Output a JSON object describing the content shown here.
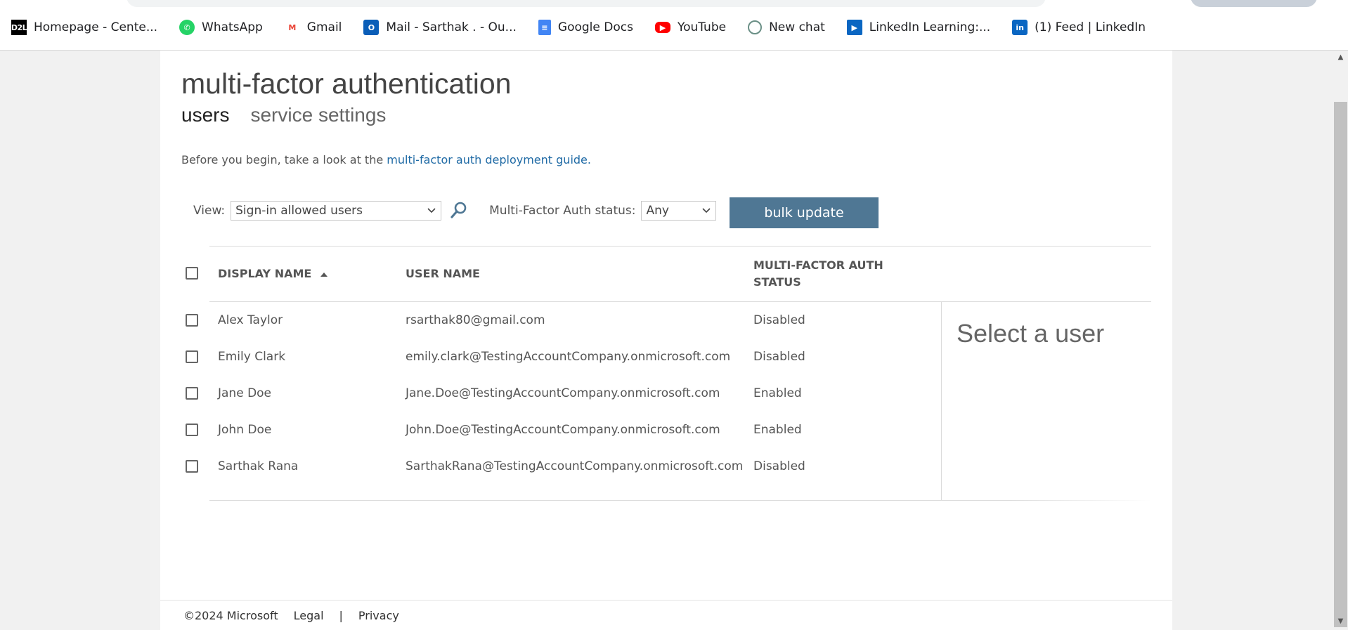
{
  "bookmarks": [
    {
      "label": "Homepage - Cente...",
      "icon": "d2l-icon"
    },
    {
      "label": "WhatsApp",
      "icon": "whatsapp-icon"
    },
    {
      "label": "Gmail",
      "icon": "gmail-icon"
    },
    {
      "label": "Mail - Sarthak . - Ou...",
      "icon": "outlook-icon"
    },
    {
      "label": "Google Docs",
      "icon": "google-docs-icon"
    },
    {
      "label": "YouTube",
      "icon": "youtube-icon"
    },
    {
      "label": "New chat",
      "icon": "chatgpt-icon"
    },
    {
      "label": "LinkedIn Learning:...",
      "icon": "linkedin-learning-icon"
    },
    {
      "label": "(1) Feed | LinkedIn",
      "icon": "linkedin-icon"
    }
  ],
  "page": {
    "title": "multi-factor authentication",
    "tabs": [
      {
        "label": "users",
        "active": true
      },
      {
        "label": "service settings",
        "active": false
      }
    ],
    "intro_text": "Before you begin, take a look at the ",
    "intro_link": "multi-factor auth deployment guide."
  },
  "filters": {
    "view_label": "View:",
    "view_value": "Sign-in allowed users",
    "mfa_label": "Multi-Factor Auth status:",
    "mfa_value": "Any",
    "bulk_update": "bulk update"
  },
  "table": {
    "columns": {
      "display_name": "DISPLAY NAME",
      "user_name": "USER NAME",
      "mfa_status_1": "MULTI-FACTOR AUTH",
      "mfa_status_2": "STATUS"
    },
    "rows": [
      {
        "display_name": "Alex Taylor",
        "user_name": "rsarthak80@gmail.com",
        "status": "Disabled"
      },
      {
        "display_name": "Emily Clark",
        "user_name": "emily.clark@TestingAccountCompany.onmicrosoft.com",
        "status": "Disabled"
      },
      {
        "display_name": "Jane Doe",
        "user_name": "Jane.Doe@TestingAccountCompany.onmicrosoft.com",
        "status": "Enabled"
      },
      {
        "display_name": "John Doe",
        "user_name": "John.Doe@TestingAccountCompany.onmicrosoft.com",
        "status": "Enabled"
      },
      {
        "display_name": "Sarthak Rana",
        "user_name": "SarthakRana@TestingAccountCompany.onmicrosoft.com",
        "status": "Disabled"
      }
    ]
  },
  "detail": {
    "placeholder": "Select a user"
  },
  "footer": {
    "copyright": "©2024 Microsoft",
    "legal": "Legal",
    "separator": "|",
    "privacy": "Privacy"
  },
  "colors": {
    "accent_button": "#4f7794",
    "link": "#1f6aa5"
  }
}
